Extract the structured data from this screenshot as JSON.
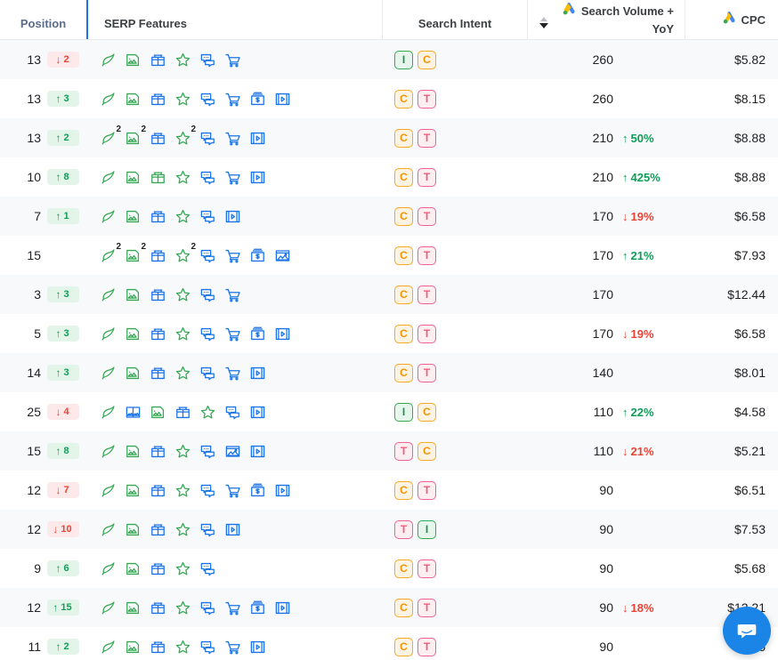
{
  "header": {
    "columns": [
      {
        "key": "position",
        "label": "Position"
      },
      {
        "key": "serp_features",
        "label": "SERP Features"
      },
      {
        "key": "search_intent",
        "label": "Search Intent"
      },
      {
        "key": "search_volume",
        "label": "Search Volume +",
        "label2": "YoY",
        "icon": "google-ads-icon",
        "sort": "descending"
      },
      {
        "key": "cpc",
        "label": "CPC",
        "icon": "google-ads-icon"
      }
    ]
  },
  "colors": {
    "accent": "#1a73e8",
    "up": "#0f9d58",
    "down": "#ea4335",
    "intent_informational": "#34a853",
    "intent_commercial": "#f9a825",
    "intent_transactional": "#f06292",
    "row_alt": "#f8f9fa",
    "chat_bubble": "#1b84e7"
  },
  "icon_legend": {
    "leaf": "leaf-icon",
    "image": "image-icon",
    "image_pack": "image-pack-icon",
    "gift": "gift-icon",
    "star": "star-icon",
    "discussion": "discussion-icon",
    "cart": "cart-icon",
    "ad": "ad-money-icon",
    "video": "video-icon",
    "photo": "photo-icon"
  },
  "rows": [
    {
      "position": "13",
      "delta": "2",
      "delta_dir": "down",
      "features": [
        {
          "icon": "leaf",
          "color": "green"
        },
        {
          "icon": "image",
          "color": "green"
        },
        {
          "icon": "gift",
          "color": "blue"
        },
        {
          "icon": "star",
          "color": "green"
        },
        {
          "icon": "discussion",
          "color": "blue"
        },
        {
          "icon": "cart",
          "color": "blue"
        }
      ],
      "intent": [
        "I",
        "C"
      ],
      "volume": "260",
      "yoy": "",
      "yoy_dir": "",
      "cpc": "$5.82"
    },
    {
      "position": "13",
      "delta": "3",
      "delta_dir": "up",
      "features": [
        {
          "icon": "leaf",
          "color": "green"
        },
        {
          "icon": "image",
          "color": "green"
        },
        {
          "icon": "gift",
          "color": "blue"
        },
        {
          "icon": "star",
          "color": "green"
        },
        {
          "icon": "discussion",
          "color": "blue"
        },
        {
          "icon": "cart",
          "color": "blue"
        },
        {
          "icon": "ad",
          "color": "blue"
        },
        {
          "icon": "video",
          "color": "blue"
        }
      ],
      "intent": [
        "C",
        "T"
      ],
      "volume": "260",
      "yoy": "",
      "yoy_dir": "",
      "cpc": "$8.15"
    },
    {
      "position": "13",
      "delta": "2",
      "delta_dir": "up",
      "features": [
        {
          "icon": "leaf",
          "color": "green",
          "count": "2"
        },
        {
          "icon": "image",
          "color": "green",
          "count": "2"
        },
        {
          "icon": "gift",
          "color": "blue"
        },
        {
          "icon": "star",
          "color": "green",
          "count": "2"
        },
        {
          "icon": "discussion",
          "color": "blue"
        },
        {
          "icon": "cart",
          "color": "blue"
        },
        {
          "icon": "video",
          "color": "blue"
        }
      ],
      "intent": [
        "C",
        "T"
      ],
      "volume": "210",
      "yoy": "50%",
      "yoy_dir": "up",
      "cpc": "$8.88"
    },
    {
      "position": "10",
      "delta": "8",
      "delta_dir": "up",
      "features": [
        {
          "icon": "leaf",
          "color": "green"
        },
        {
          "icon": "image",
          "color": "green"
        },
        {
          "icon": "gift",
          "color": "green"
        },
        {
          "icon": "star",
          "color": "green"
        },
        {
          "icon": "discussion",
          "color": "blue"
        },
        {
          "icon": "cart",
          "color": "blue"
        },
        {
          "icon": "video",
          "color": "blue"
        }
      ],
      "intent": [
        "C",
        "T"
      ],
      "volume": "210",
      "yoy": "425%",
      "yoy_dir": "up",
      "cpc": "$8.88"
    },
    {
      "position": "7",
      "delta": "1",
      "delta_dir": "up",
      "features": [
        {
          "icon": "leaf",
          "color": "green"
        },
        {
          "icon": "image",
          "color": "green"
        },
        {
          "icon": "gift",
          "color": "blue"
        },
        {
          "icon": "star",
          "color": "green"
        },
        {
          "icon": "discussion",
          "color": "blue"
        },
        {
          "icon": "video",
          "color": "blue"
        }
      ],
      "intent": [
        "C",
        "T"
      ],
      "volume": "170",
      "yoy": "19%",
      "yoy_dir": "down",
      "cpc": "$6.58"
    },
    {
      "position": "15",
      "delta": "",
      "delta_dir": "",
      "features": [
        {
          "icon": "leaf",
          "color": "green",
          "count": "2"
        },
        {
          "icon": "image",
          "color": "green",
          "count": "2"
        },
        {
          "icon": "gift",
          "color": "blue"
        },
        {
          "icon": "star",
          "color": "green",
          "count": "2"
        },
        {
          "icon": "discussion",
          "color": "blue"
        },
        {
          "icon": "cart",
          "color": "blue"
        },
        {
          "icon": "ad",
          "color": "blue"
        },
        {
          "icon": "photo",
          "color": "blue"
        }
      ],
      "intent": [
        "C",
        "T"
      ],
      "volume": "170",
      "yoy": "21%",
      "yoy_dir": "up",
      "cpc": "$7.93"
    },
    {
      "position": "3",
      "delta": "3",
      "delta_dir": "up",
      "features": [
        {
          "icon": "leaf",
          "color": "green"
        },
        {
          "icon": "image",
          "color": "green"
        },
        {
          "icon": "gift",
          "color": "blue"
        },
        {
          "icon": "star",
          "color": "green"
        },
        {
          "icon": "discussion",
          "color": "blue"
        },
        {
          "icon": "cart",
          "color": "blue"
        }
      ],
      "intent": [
        "C",
        "T"
      ],
      "volume": "170",
      "yoy": "",
      "yoy_dir": "",
      "cpc": "$12.44"
    },
    {
      "position": "5",
      "delta": "3",
      "delta_dir": "up",
      "features": [
        {
          "icon": "leaf",
          "color": "green"
        },
        {
          "icon": "image",
          "color": "green"
        },
        {
          "icon": "gift",
          "color": "blue"
        },
        {
          "icon": "star",
          "color": "green"
        },
        {
          "icon": "discussion",
          "color": "blue"
        },
        {
          "icon": "cart",
          "color": "blue"
        },
        {
          "icon": "ad",
          "color": "blue"
        },
        {
          "icon": "video",
          "color": "blue"
        }
      ],
      "intent": [
        "C",
        "T"
      ],
      "volume": "170",
      "yoy": "19%",
      "yoy_dir": "down",
      "cpc": "$6.58"
    },
    {
      "position": "14",
      "delta": "3",
      "delta_dir": "up",
      "features": [
        {
          "icon": "leaf",
          "color": "green"
        },
        {
          "icon": "image",
          "color": "green"
        },
        {
          "icon": "gift",
          "color": "blue"
        },
        {
          "icon": "star",
          "color": "green"
        },
        {
          "icon": "discussion",
          "color": "blue"
        },
        {
          "icon": "cart",
          "color": "blue"
        },
        {
          "icon": "video",
          "color": "blue"
        }
      ],
      "intent": [
        "C",
        "T"
      ],
      "volume": "140",
      "yoy": "",
      "yoy_dir": "",
      "cpc": "$8.01"
    },
    {
      "position": "25",
      "delta": "4",
      "delta_dir": "down",
      "features": [
        {
          "icon": "leaf",
          "color": "green"
        },
        {
          "icon": "image_pack",
          "color": "blue"
        },
        {
          "icon": "image",
          "color": "green"
        },
        {
          "icon": "gift",
          "color": "blue"
        },
        {
          "icon": "star",
          "color": "green"
        },
        {
          "icon": "discussion",
          "color": "blue"
        },
        {
          "icon": "video",
          "color": "blue"
        }
      ],
      "intent": [
        "I",
        "C"
      ],
      "volume": "110",
      "yoy": "22%",
      "yoy_dir": "up",
      "cpc": "$4.58"
    },
    {
      "position": "15",
      "delta": "8",
      "delta_dir": "up",
      "features": [
        {
          "icon": "leaf",
          "color": "green"
        },
        {
          "icon": "image",
          "color": "green"
        },
        {
          "icon": "gift",
          "color": "blue"
        },
        {
          "icon": "star",
          "color": "green"
        },
        {
          "icon": "discussion",
          "color": "blue"
        },
        {
          "icon": "photo",
          "color": "blue"
        },
        {
          "icon": "video",
          "color": "blue"
        }
      ],
      "intent": [
        "T",
        "C"
      ],
      "volume": "110",
      "yoy": "21%",
      "yoy_dir": "down",
      "cpc": "$5.21"
    },
    {
      "position": "12",
      "delta": "7",
      "delta_dir": "down",
      "features": [
        {
          "icon": "leaf",
          "color": "green"
        },
        {
          "icon": "image",
          "color": "green"
        },
        {
          "icon": "gift",
          "color": "blue"
        },
        {
          "icon": "star",
          "color": "green"
        },
        {
          "icon": "discussion",
          "color": "blue"
        },
        {
          "icon": "cart",
          "color": "blue"
        },
        {
          "icon": "ad",
          "color": "blue"
        },
        {
          "icon": "video",
          "color": "blue"
        }
      ],
      "intent": [
        "C",
        "T"
      ],
      "volume": "90",
      "yoy": "",
      "yoy_dir": "",
      "cpc": "$6.51"
    },
    {
      "position": "12",
      "delta": "10",
      "delta_dir": "down",
      "features": [
        {
          "icon": "leaf",
          "color": "green"
        },
        {
          "icon": "image",
          "color": "green"
        },
        {
          "icon": "gift",
          "color": "blue"
        },
        {
          "icon": "star",
          "color": "green"
        },
        {
          "icon": "discussion",
          "color": "blue"
        },
        {
          "icon": "video",
          "color": "blue"
        }
      ],
      "intent": [
        "T",
        "I"
      ],
      "volume": "90",
      "yoy": "",
      "yoy_dir": "",
      "cpc": "$7.53"
    },
    {
      "position": "9",
      "delta": "6",
      "delta_dir": "up",
      "features": [
        {
          "icon": "leaf",
          "color": "green"
        },
        {
          "icon": "image",
          "color": "green"
        },
        {
          "icon": "gift",
          "color": "blue"
        },
        {
          "icon": "star",
          "color": "green"
        },
        {
          "icon": "discussion",
          "color": "blue"
        }
      ],
      "intent": [
        "C",
        "T"
      ],
      "volume": "90",
      "yoy": "",
      "yoy_dir": "",
      "cpc": "$5.68"
    },
    {
      "position": "12",
      "delta": "15",
      "delta_dir": "up",
      "features": [
        {
          "icon": "leaf",
          "color": "green"
        },
        {
          "icon": "image",
          "color": "green"
        },
        {
          "icon": "gift",
          "color": "blue"
        },
        {
          "icon": "star",
          "color": "green"
        },
        {
          "icon": "discussion",
          "color": "blue"
        },
        {
          "icon": "cart",
          "color": "blue"
        },
        {
          "icon": "ad",
          "color": "blue"
        },
        {
          "icon": "video",
          "color": "blue"
        }
      ],
      "intent": [
        "C",
        "T"
      ],
      "volume": "90",
      "yoy": "18%",
      "yoy_dir": "down",
      "cpc": "$12.21"
    },
    {
      "position": "11",
      "delta": "2",
      "delta_dir": "up",
      "features": [
        {
          "icon": "leaf",
          "color": "green"
        },
        {
          "icon": "image",
          "color": "green"
        },
        {
          "icon": "gift",
          "color": "blue"
        },
        {
          "icon": "star",
          "color": "green"
        },
        {
          "icon": "discussion",
          "color": "blue"
        },
        {
          "icon": "cart",
          "color": "blue"
        },
        {
          "icon": "video",
          "color": "blue"
        }
      ],
      "intent": [
        "C",
        "T"
      ],
      "volume": "90",
      "yoy": "",
      "yoy_dir": "",
      "cpc": "$6.5"
    }
  ],
  "chat_widget": {
    "name": "chat-bubble-icon"
  }
}
